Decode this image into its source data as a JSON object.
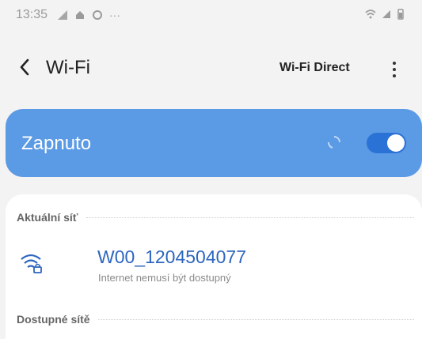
{
  "status_bar": {
    "time": "13:35",
    "more": "···"
  },
  "header": {
    "back_icon": "chevron-left-icon",
    "title": "Wi-Fi",
    "direct_label": "Wi-Fi Direct",
    "more_icon": "more-vertical-icon"
  },
  "wifi_toggle": {
    "label": "Zapnuto",
    "state": "on",
    "scan_indicator": "spinner-icon"
  },
  "sections": {
    "current": {
      "title": "Aktuální síť"
    },
    "available": {
      "title": "Dostupné sítě"
    }
  },
  "current_network": {
    "name": "W00_1204504077",
    "status": "Internet nemusí být dostupný",
    "icon": "wifi-lock-icon"
  },
  "colors": {
    "accent": "#5b9ae4",
    "toggle": "#2b72d6",
    "network_name": "#2d66bf",
    "background": "#f3f3f3"
  }
}
